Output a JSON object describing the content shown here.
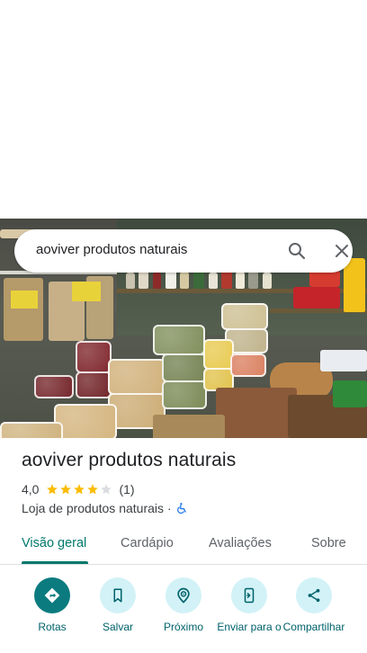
{
  "search": {
    "query": "aoviver produtos naturais",
    "search_icon": "search-icon",
    "close_icon": "close-icon"
  },
  "place": {
    "name": "aoviver produtos naturais",
    "rating": "4,0",
    "stars_filled": 4,
    "stars_total": 5,
    "review_count": "(1)",
    "category": "Loja de produtos naturais",
    "separator": "·",
    "accessibility_icon": "wheelchair-icon"
  },
  "tabs": [
    {
      "label": "Visão geral",
      "active": true
    },
    {
      "label": "Cardápio",
      "active": false
    },
    {
      "label": "Avaliações",
      "active": false
    },
    {
      "label": "Sobre",
      "active": false
    }
  ],
  "actions": [
    {
      "label": "Rotas",
      "icon": "directions-icon"
    },
    {
      "label": "Salvar",
      "icon": "bookmark-icon"
    },
    {
      "label": "Próximo",
      "icon": "nearby-icon"
    },
    {
      "label": "Enviar para o",
      "icon": "send-to-phone-icon"
    },
    {
      "label": "Compartilhar",
      "icon": "share-icon"
    }
  ],
  "colors": {
    "accent": "#00796b",
    "star": "#fbbc04",
    "star_empty": "#dadce0",
    "action_bg": "#d2f2f7",
    "primary_action_bg": "#0b7b7f"
  }
}
